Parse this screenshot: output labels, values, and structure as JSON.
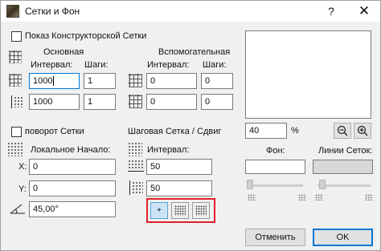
{
  "window": {
    "title": "Сетки и Фон",
    "help": "?",
    "close": "✕"
  },
  "construction_grid": {
    "show_label": "Показ Конструкторской Сетки",
    "main_label": "Основная",
    "aux_label": "Вспомогательная",
    "interval_label": "Интервал:",
    "steps_label": "Шаги:",
    "main_x_interval": "1000",
    "main_x_steps": "1",
    "main_y_interval": "1000",
    "main_y_steps": "1",
    "aux_x_interval": "0",
    "aux_x_steps": "0",
    "aux_y_interval": "0",
    "aux_y_steps": "0"
  },
  "rotation": {
    "rotate_label": "поворот Сетки",
    "local_origin_label": "Локальное Начало:",
    "x_label": "X:",
    "x_value": "0",
    "y_label": "Y:",
    "y_value": "0",
    "angle_value": "45,00°"
  },
  "snap_grid": {
    "label": "Шаговая Сетка / Сдвиг",
    "interval_label": "Интервал:",
    "x_value": "50",
    "y_value": "50",
    "modes": [
      "plus",
      "dot-grid",
      "dot-grid-2"
    ]
  },
  "preview_panel": {
    "zoom_value": "40",
    "zoom_unit": "%",
    "zoom_out_icon": "zoom-out-icon",
    "zoom_in_icon": "zoom-in-icon",
    "background_label": "Фон:",
    "grid_lines_label": "Линии Сеток:",
    "background_color": "#ffffff",
    "grid_line_color": "#d8d8d8"
  },
  "buttons": {
    "cancel": "Отменить",
    "ok": "OK"
  }
}
